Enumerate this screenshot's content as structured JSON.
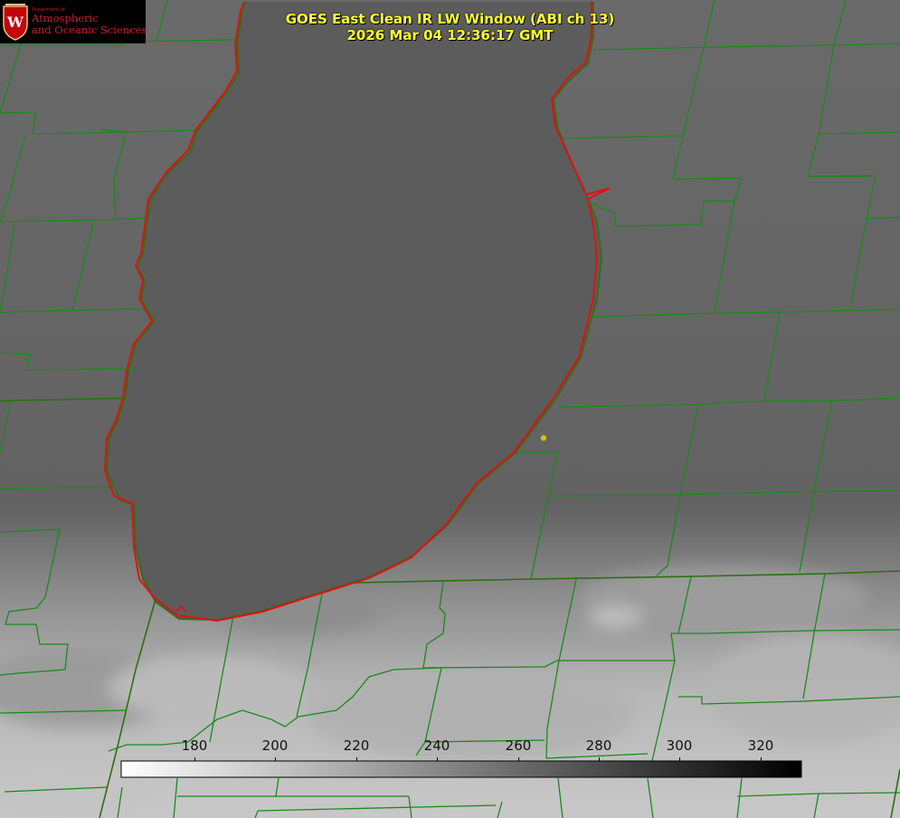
{
  "title_line1": "GOES East Clean IR LW Window (ABI ch 13)",
  "title_line2": "2026 Mar 04 12:36:17 GMT",
  "logo": {
    "department": "Department of",
    "line1": "Atmospheric",
    "line2": "and Oceanic Sciences",
    "seal_letter": "W",
    "accent_color": "#c5050c"
  },
  "colorbar": {
    "ticks": [
      "180",
      "200",
      "220",
      "240",
      "260",
      "280",
      "300",
      "320"
    ],
    "gradient": "white-to-black"
  },
  "colors": {
    "boundary_line": "#1a8a1a",
    "coastline": "#e01010",
    "marker": "#d4c000",
    "title": "#ffff33"
  }
}
